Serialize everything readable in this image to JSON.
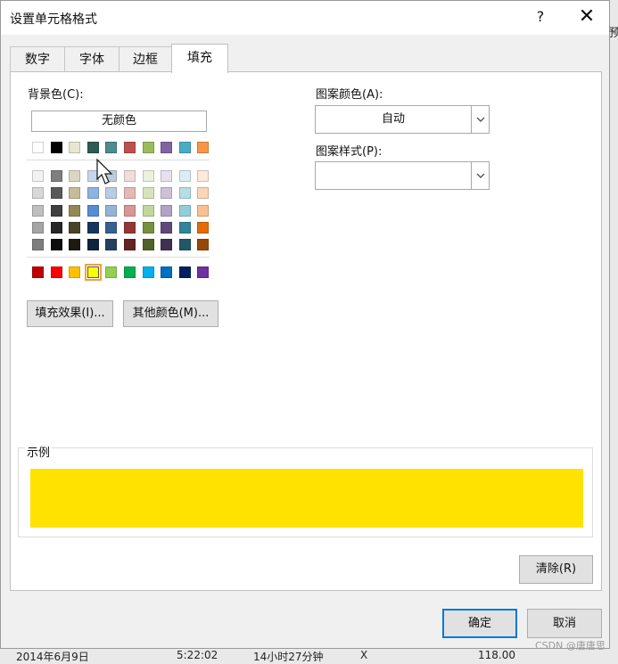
{
  "dialog": {
    "title": "设置单元格格式",
    "help_glyph": "?",
    "close_glyph": "✕"
  },
  "tabs": [
    {
      "label": "数字"
    },
    {
      "label": "字体"
    },
    {
      "label": "边框"
    },
    {
      "label": "填充",
      "active": true
    }
  ],
  "fill": {
    "background_label": "背景色(C):",
    "no_color_label": "无颜色",
    "fill_effects_label": "填充效果(I)...",
    "more_colors_label": "其他颜色(M)...",
    "pattern_color_label": "图案颜色(A):",
    "pattern_color_value": "自动",
    "pattern_style_label": "图案样式(P):",
    "pattern_style_value": "",
    "sample_label": "示例",
    "sample_color": "#ffe200",
    "clear_label": "清除(R)"
  },
  "palette": {
    "theme_colors": [
      "#ffffff",
      "#000000",
      "#e7e6cf",
      "#2e5a54",
      "#4e8b8d",
      "#c0504d",
      "#9bbb59",
      "#8064a2",
      "#4bacc6",
      "#f79646"
    ],
    "tint_rows": [
      [
        "#f2f2f2",
        "#7f7f7f",
        "#d9d6c1",
        "#c7d7ea",
        "#bcccdc",
        "#f2dcdb",
        "#ebf1dd",
        "#e5e0ec",
        "#dbeef3",
        "#fde9d9"
      ],
      [
        "#d8d8d8",
        "#595959",
        "#c4bd97",
        "#8db3e2",
        "#b8cce4",
        "#e5b9b7",
        "#d7e3bc",
        "#ccc1d9",
        "#b7dde8",
        "#fbd5b5"
      ],
      [
        "#bfbfbf",
        "#3f3f3f",
        "#938953",
        "#548dd4",
        "#95b3d7",
        "#d99694",
        "#c3d69b",
        "#b2a2c7",
        "#92cddc",
        "#fac08f"
      ],
      [
        "#a5a5a5",
        "#262626",
        "#494429",
        "#17365d",
        "#366092",
        "#953734",
        "#76923c",
        "#5f497a",
        "#31859b",
        "#e36c09"
      ],
      [
        "#7f7f7f",
        "#0c0c0c",
        "#1d1b10",
        "#0f243e",
        "#244061",
        "#632423",
        "#4f6128",
        "#3f3151",
        "#205867",
        "#974806"
      ]
    ],
    "standard_colors": [
      "#c00000",
      "#ff0000",
      "#ffc000",
      "#ffff00",
      "#92d050",
      "#00b050",
      "#00b0f0",
      "#0070c0",
      "#002060",
      "#7030a0"
    ],
    "selected": "#ffff00"
  },
  "footer": {
    "ok_label": "确定",
    "cancel_label": "取消"
  },
  "background": {
    "left_text": "2014年6月9日",
    "mid_text": "5:22:02",
    "right_text": "14小时27分钟",
    "x_text": "X",
    "num_text": "118.00",
    "edge_glyph": "预"
  },
  "watermark": "CSDN @唐唐思"
}
